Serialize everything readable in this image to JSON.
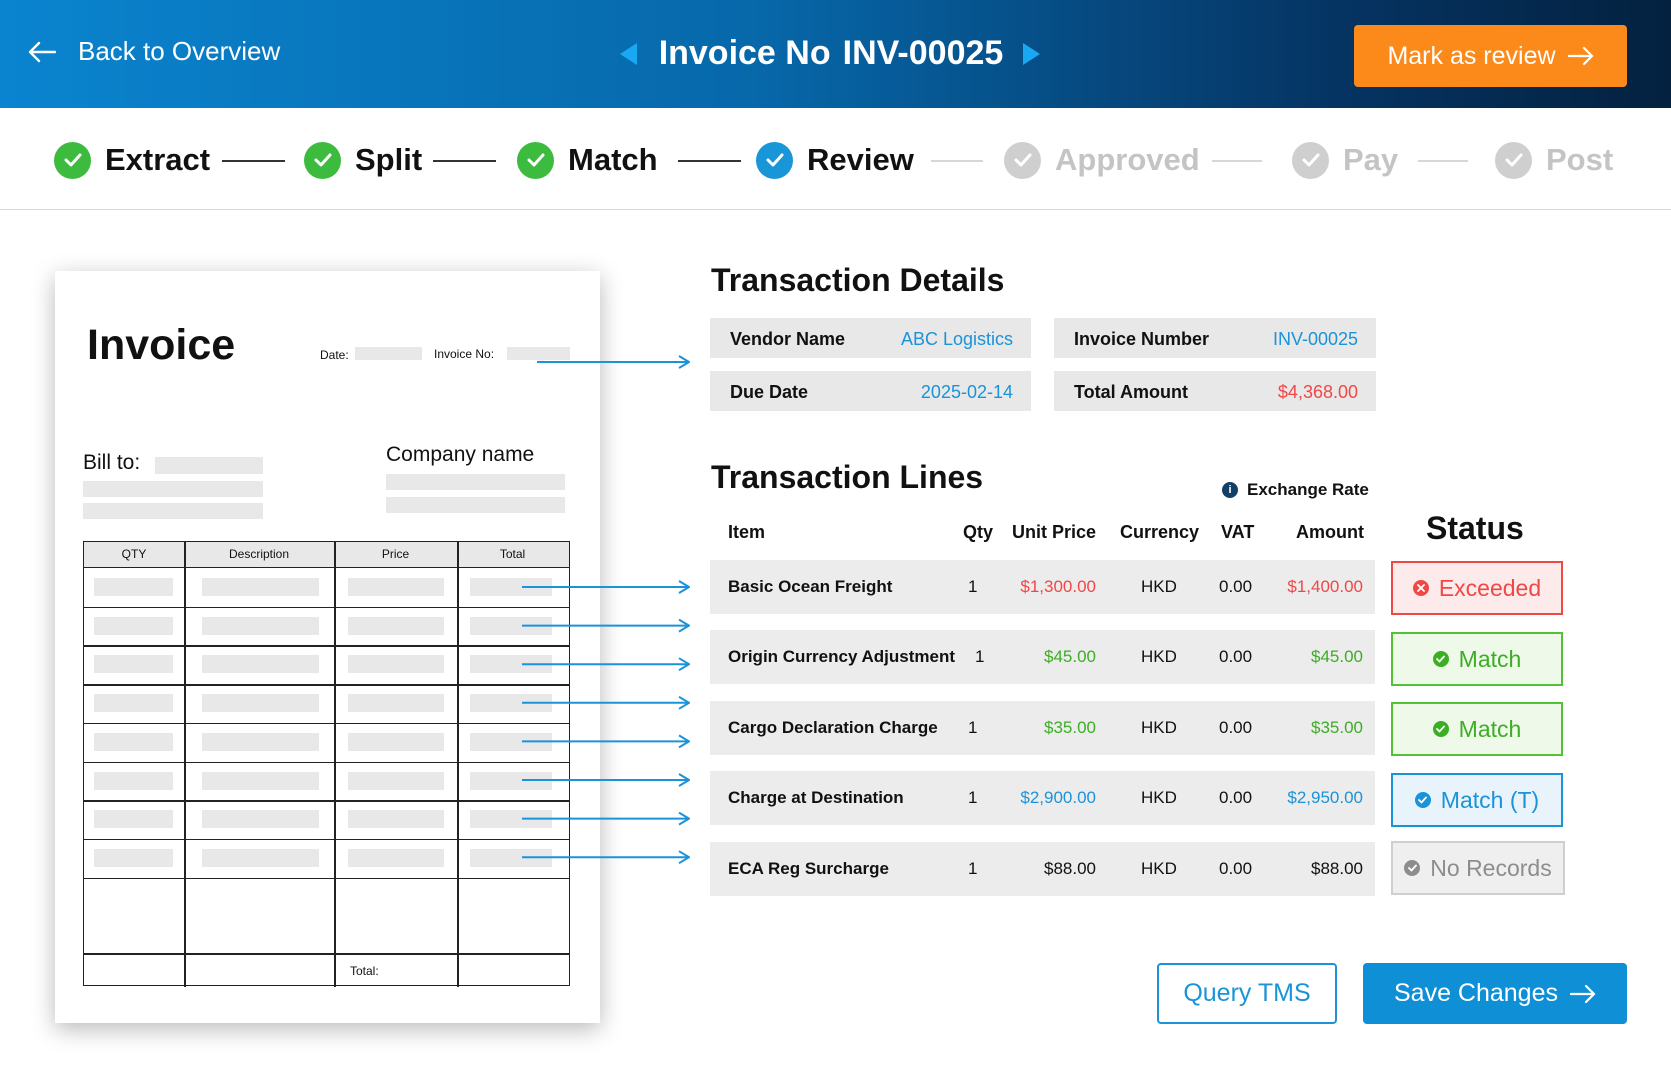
{
  "header": {
    "back_label": "Back to Overview",
    "invoice_label": "Invoice No",
    "invoice_number": "INV-00025",
    "mark_button": "Mark as review"
  },
  "stepper": {
    "steps": [
      {
        "label": "Extract",
        "state": "done"
      },
      {
        "label": "Split",
        "state": "done"
      },
      {
        "label": "Match",
        "state": "done"
      },
      {
        "label": "Review",
        "state": "current"
      },
      {
        "label": "Approved",
        "state": "pending"
      },
      {
        "label": "Pay",
        "state": "pending"
      },
      {
        "label": "Post",
        "state": "pending"
      }
    ]
  },
  "paper": {
    "title": "Invoice",
    "date_label": "Date:",
    "invoice_no_label": "Invoice No:",
    "bill_to": "Bill to:",
    "company_name": "Company name",
    "columns": [
      "QTY",
      "Description",
      "Price",
      "Total"
    ],
    "total_label": "Total:"
  },
  "details": {
    "title": "Transaction Details",
    "vendor_name_label": "Vendor Name",
    "vendor_name": "ABC Logistics",
    "invoice_number_label": "Invoice Number",
    "invoice_number": "INV-00025",
    "due_date_label": "Due Date",
    "due_date": "2025-02-14",
    "total_amount_label": "Total Amount",
    "total_amount": "$4,368.00"
  },
  "lines": {
    "title": "Transaction Lines",
    "exchange_rate": "Exchange Rate",
    "columns": {
      "item": "Item",
      "qty": "Qty",
      "unit_price": "Unit Price",
      "currency": "Currency",
      "vat": "VAT",
      "amount": "Amount"
    },
    "status_title": "Status",
    "rows": [
      {
        "item": "Basic Ocean Freight",
        "qty": "1",
        "unit_price": "$1,300.00",
        "currency": "HKD",
        "vat": "0.00",
        "amount": "$1,400.00",
        "status": "Exceeded"
      },
      {
        "item": "Origin Currency Adjustment",
        "qty": "1",
        "unit_price": "$45.00",
        "currency": "HKD",
        "vat": "0.00",
        "amount": "$45.00",
        "status": "Match"
      },
      {
        "item": "Cargo Declaration Charge",
        "qty": "1",
        "unit_price": "$35.00",
        "currency": "HKD",
        "vat": "0.00",
        "amount": "$35.00",
        "status": "Match"
      },
      {
        "item": "Charge at Destination",
        "qty": "1",
        "unit_price": "$2,900.00",
        "currency": "HKD",
        "vat": "0.00",
        "amount": "$2,950.00",
        "status": "Match (T)"
      },
      {
        "item": "ECA Reg Surcharge",
        "qty": "1",
        "unit_price": "$88.00",
        "currency": "HKD",
        "vat": "0.00",
        "amount": "$88.00",
        "status": "No Records"
      }
    ]
  },
  "actions": {
    "query_button": "Query TMS",
    "save_button": "Save Changes"
  },
  "colors": {
    "accent_blue": "#1b93d8",
    "orange": "#fb8a1a",
    "red": "#f04747",
    "green": "#3cae24",
    "gray": "#8d8d8d"
  }
}
